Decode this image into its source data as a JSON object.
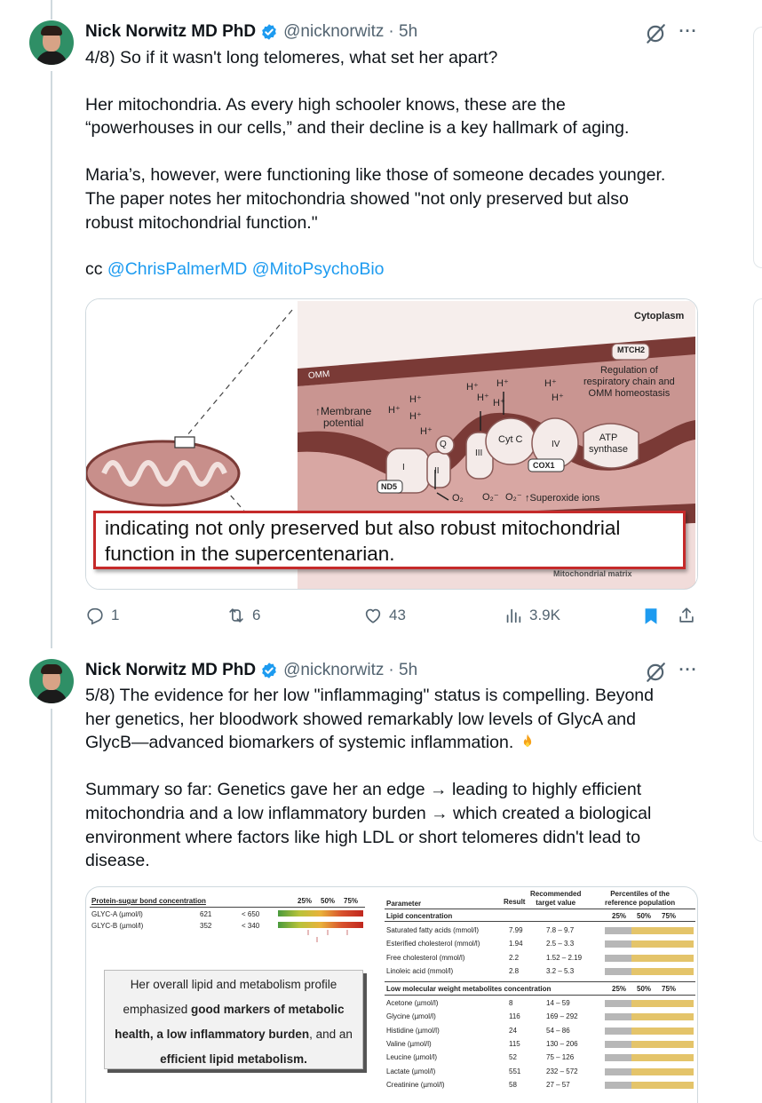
{
  "tweets": [
    {
      "author_name": "Nick Norwitz MD PhD",
      "handle": "@nicknorwitz",
      "time": "· 5h",
      "lines": [
        "4/8) So if it wasn't long telomeres, what set her apart?",
        "Her mitochondria. As every high schooler knows, these are the\n“powerhouses in our cells,” and their decline is a key hallmark of aging.",
        "Maria’s, however, were functioning like those of someone decades younger.\nThe paper notes her mitochondria showed \"not only preserved but also\nrobust mitochondrial function.\""
      ],
      "cc_prefix": "cc ",
      "mentions": [
        "@ChrisPalmerMD",
        "@MitoPsychoBio"
      ],
      "stats": {
        "replies": "1",
        "reposts": "6",
        "likes": "43",
        "views": "3.9K"
      }
    },
    {
      "author_name": "Nick Norwitz MD PhD",
      "handle": "@nicknorwitz",
      "time": "· 5h",
      "lines": [
        "5/8) The evidence for her low \"inflammaging\" status is compelling. Beyond\nher genetics, her bloodwork showed remarkably low levels of GlycA and\nGlycB—advanced biomarkers of systemic inflammation.",
        "Summary so far: Genetics gave her an edge → leading to highly efficient\nmitochondria and a low inflammatory burden → which created a biological\nenvironment where factors like high LDL or short telomeres didn't lead to\ndisease."
      ],
      "emoji": "fire-emoji"
    }
  ],
  "figure1": {
    "labels": {
      "cytoplasm": "Cytoplasm",
      "mtch2": "MTCH2",
      "regulation": "Regulation of\nrespiratory chain and\nOMM homeostasis",
      "omm": "OMM",
      "membrane": "↑Membrane\npotential",
      "h": "H⁺",
      "cytc": "Cyt C",
      "q": "Q",
      "i": "I",
      "ii": "II",
      "iii": "III",
      "iv": "IV",
      "atp": "ATP\nsynthase",
      "nd5": "ND5",
      "cox1": "COX1",
      "o2": "O₂",
      "o2sup": "O₂⁻",
      "superoxide": "↑Superoxide ions",
      "matrix": "Mitochondrial matrix"
    },
    "overlay_lines": [
      "indicating not only preserved but also robust mitochondrial",
      "function in the supercentenarian."
    ]
  },
  "figure2": {
    "glyc": {
      "header": "Protein-sugar bond concentration",
      "percentiles": [
        "25%",
        "50%",
        "75%"
      ],
      "rows": [
        {
          "name": "GLYC-A (µmol/l)",
          "value": "621",
          "target": "< 650"
        },
        {
          "name": "GLYC-B (µmol/l)",
          "value": "352",
          "target": "< 340"
        }
      ]
    },
    "summary": {
      "pre": "Her overall lipid and metabolism profile",
      "l2a": "emphasized ",
      "l2b": "good markers of metabolic",
      "l3a": "health, ",
      "l3b": "a low inflammatory burden",
      "l3c": ", and an",
      "l4": "efficient lipid metabolism."
    },
    "table": {
      "col_parameter": "Parameter",
      "col_result": "Result",
      "col_target": "Recommended\ntarget value",
      "col_pct": "Percentiles of the\nreference population",
      "pcts": [
        "25%",
        "50%",
        "75%"
      ],
      "section1": "Lipid concentration",
      "lipids": [
        {
          "name": "Saturated fatty acids (mmol/l)",
          "result": "7.99",
          "target": "7.8 – 9.7"
        },
        {
          "name": "Esterified cholesterol (mmol/l)",
          "result": "1.94",
          "target": "2.5 – 3.3"
        },
        {
          "name": "Free cholesterol (mmol/l)",
          "result": "2.2",
          "target": "1.52 – 2.19"
        },
        {
          "name": "Linoleic acid (mmol/l)",
          "result": "2.8",
          "target": "3.2 – 5.3"
        }
      ],
      "section2": "Low molecular weight metabolites concentration",
      "metabolites": [
        {
          "name": "Acetone (µmol/l)",
          "result": "8",
          "target": "14 – 59"
        },
        {
          "name": "Glycine (µmol/l)",
          "result": "116",
          "target": "169 – 292"
        },
        {
          "name": "Histidine (µmol/l)",
          "result": "24",
          "target": "54 – 86"
        },
        {
          "name": "Valine (µmol/l)",
          "result": "115",
          "target": "130 – 206"
        },
        {
          "name": "Leucine (µmol/l)",
          "result": "52",
          "target": "75 – 126"
        },
        {
          "name": "Lactate (µmol/l)",
          "result": "551",
          "target": "232 – 572"
        },
        {
          "name": "Creatinine (µmol/l)",
          "result": "58",
          "target": "27 – 57"
        }
      ]
    }
  },
  "colors": {
    "blue": "#1d9bf0",
    "gray": "#536471",
    "text": "#0f1419"
  }
}
